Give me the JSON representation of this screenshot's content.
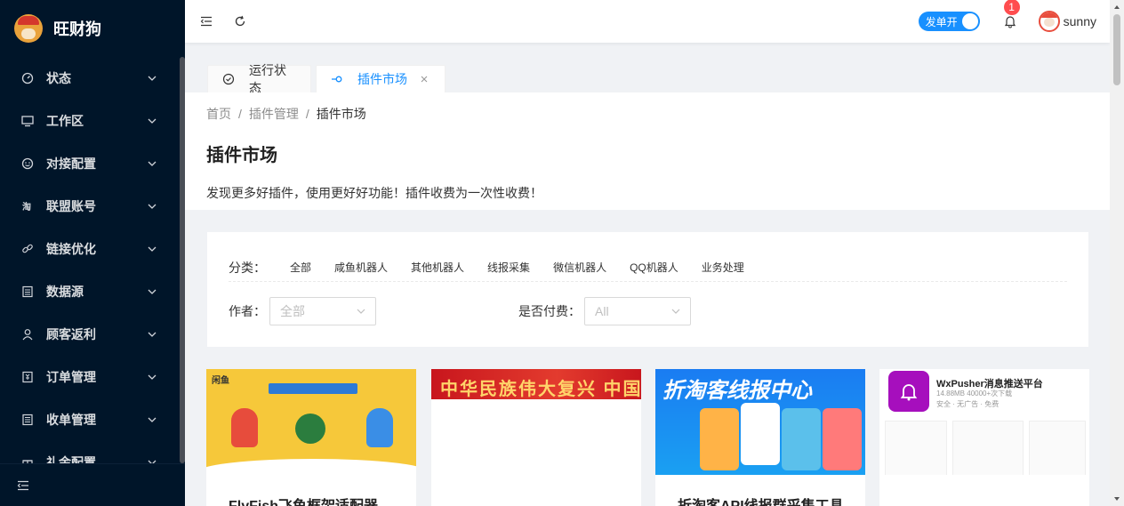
{
  "app": {
    "name": "旺财狗"
  },
  "sidebar": {
    "items": [
      {
        "label": "状态",
        "icon": "dashboard-icon"
      },
      {
        "label": "工作区",
        "icon": "desktop-icon"
      },
      {
        "label": "对接配置",
        "icon": "smile-icon"
      },
      {
        "label": "联盟账号",
        "icon": "taobao-icon"
      },
      {
        "label": "链接优化",
        "icon": "link-icon"
      },
      {
        "label": "数据源",
        "icon": "database-icon"
      },
      {
        "label": "顾客返利",
        "icon": "user-icon"
      },
      {
        "label": "订单管理",
        "icon": "order-icon"
      },
      {
        "label": "收单管理",
        "icon": "receipt-icon"
      },
      {
        "label": "礼金配置",
        "icon": "gift-icon"
      }
    ]
  },
  "header": {
    "switch_label": "发单开",
    "notification_count": "1",
    "username": "sunny"
  },
  "tabs": [
    {
      "label": "运行状态",
      "icon": "clock-check-icon"
    },
    {
      "label": "插件市场",
      "icon": "plugin-icon"
    }
  ],
  "breadcrumb": [
    "首页",
    "插件管理",
    "插件市场"
  ],
  "page": {
    "title": "插件市场",
    "description": "发现更多好插件，使用更好好功能！插件收费为一次性收费！"
  },
  "filters": {
    "category_label": "分类：",
    "categories": [
      "全部",
      "咸鱼机器人",
      "其他机器人",
      "线报采集",
      "微信机器人",
      "QQ机器人",
      "业务处理"
    ],
    "author_label": "作者：",
    "author_value": "全部",
    "paid_label": "是否付费：",
    "paid_value": "All"
  },
  "cards": [
    {
      "title": "FlyFish飞鱼框架适配器",
      "cover_logo": "闲鱼"
    },
    {
      "title": "",
      "cover_text": "中华民族伟大复兴 中国梦"
    },
    {
      "title": "折淘客API线报群采集工具",
      "cover_text": "折淘客线报中心"
    },
    {
      "title": "",
      "app_name": "WxPusher消息推送平台",
      "app_meta": "14.88MB  40000+次下载",
      "app_tags": "安全 · 无广告 · 免费"
    }
  ],
  "colors": {
    "accent": "#1890ff",
    "sidebar_bg": "#001529",
    "badge": "#ff4d4f"
  }
}
